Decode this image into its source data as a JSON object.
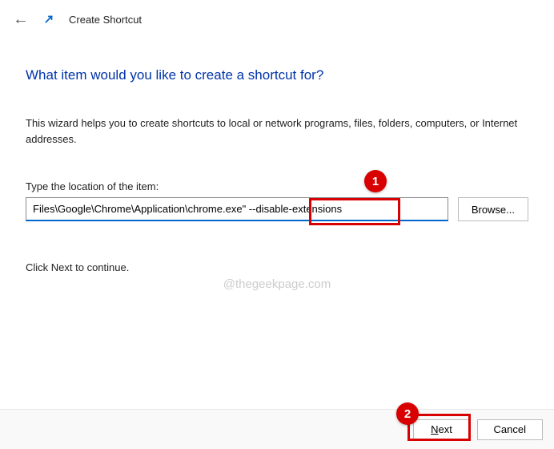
{
  "header": {
    "title": "Create Shortcut"
  },
  "main": {
    "heading": "What item would you like to create a shortcut for?",
    "description": "This wizard helps you to create shortcuts to local or network programs, files, folders, computers, or Internet addresses.",
    "field_label": "Type the location of the item:",
    "path_value": "Files\\Google\\Chrome\\Application\\chrome.exe\" --disable-extensions",
    "browse_label": "Browse...",
    "continue_text": "Click Next to continue."
  },
  "footer": {
    "next_prefix": "N",
    "next_rest": "ext",
    "cancel_label": "Cancel"
  },
  "watermark": "@thegeekpage.com",
  "annotations": {
    "badge1": "1",
    "badge2": "2"
  }
}
